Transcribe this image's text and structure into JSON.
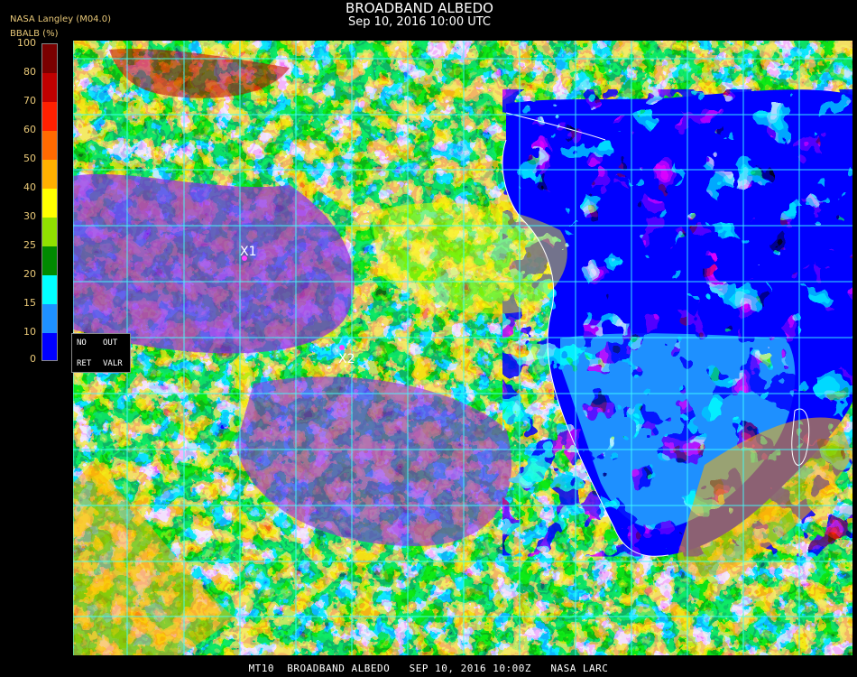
{
  "header": {
    "title": "BROADBAND ALBEDO",
    "subtitle": "Sep 10, 2016 10:00 UTC",
    "producer": "NASA Langley (M04.0)",
    "units": "BBALB (%)"
  },
  "colorbar": {
    "ticks": [
      "100",
      "80",
      "70",
      "60",
      "50",
      "40",
      "30",
      "25",
      "20",
      "15",
      "10",
      "0"
    ],
    "colors": [
      "#7a0000",
      "#c00000",
      "#ff2000",
      "#ff6a00",
      "#ffb000",
      "#ffff00",
      "#90e000",
      "#008a00",
      "#00ffff",
      "#1e90ff",
      "#0000ff",
      "#8a2be2"
    ]
  },
  "legend": {
    "no": "NO",
    "out": "OUT",
    "ret": "RET",
    "valr": "VALR"
  },
  "markers": [
    {
      "label": "X1"
    },
    {
      "label": "X2"
    }
  ],
  "map": {
    "ocean_color": "#8a2be2",
    "land_color": "#0000ff",
    "grid_color": "#40ffff",
    "coast_color": "#ffffff"
  },
  "footer": "MT10  BROADBAND ALBEDO   SEP 10, 2016 10:00Z   NASA LARC"
}
